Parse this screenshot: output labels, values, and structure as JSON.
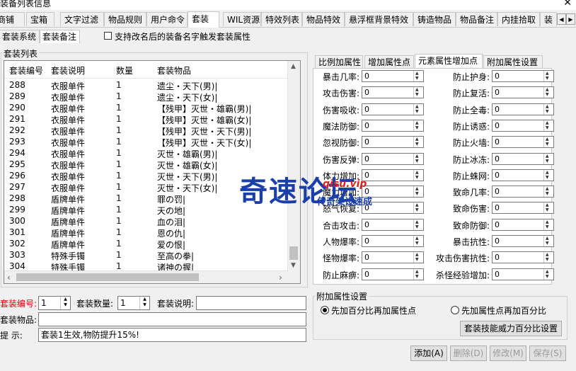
{
  "window": {
    "title": "装备列表信息",
    "close_glyph": "✕"
  },
  "top_tabs": [
    "商铺",
    "宝箱",
    "文字过滤",
    "物品规则",
    "用户命令",
    "套装",
    "WIL资源",
    "特效列表",
    "物品特效",
    "悬浮框背景特效",
    "铸造物品",
    "物品备注",
    "内挂拾取",
    "装"
  ],
  "sub_tabs": [
    "套装系统",
    "套装备注"
  ],
  "option_checkbox": {
    "label": "支持改名后的装备名字触发套装属性",
    "checked": false
  },
  "list_group": {
    "label": "套装列表",
    "columns": [
      "套装编号",
      "套装说明",
      "数量",
      "套装物品"
    ],
    "rows": [
      [
        "288",
        "衣服单件",
        "1",
        "遗尘・天下(男)|"
      ],
      [
        "289",
        "衣服单件",
        "1",
        "遗尘・天下(女)|"
      ],
      [
        "290",
        "衣服单件",
        "1",
        "【残甲】灭世・雄霸(男)|"
      ],
      [
        "291",
        "衣服单件",
        "1",
        "【残甲】灭世・雄霸(女)|"
      ],
      [
        "292",
        "衣服单件",
        "1",
        "【残甲】灭世・天下(男)|"
      ],
      [
        "293",
        "衣服单件",
        "1",
        "【残甲】灭世・天下(女)|"
      ],
      [
        "294",
        "衣服单件",
        "1",
        "灭世・雄霸(男)|"
      ],
      [
        "295",
        "衣服单件",
        "1",
        "灭世・雄霸(女)|"
      ],
      [
        "296",
        "衣服单件",
        "1",
        "灭世・天下(男)|"
      ],
      [
        "297",
        "衣服单件",
        "1",
        "灭世・天下(女)|"
      ],
      [
        "298",
        "盾牌单件",
        "1",
        "罪の罚|"
      ],
      [
        "299",
        "盾牌单件",
        "1",
        "天の地|"
      ],
      [
        "300",
        "盾牌单件",
        "1",
        "血の泪|"
      ],
      [
        "301",
        "盾牌单件",
        "1",
        "恩の仇|"
      ],
      [
        "302",
        "盾牌单件",
        "1",
        "爱の恨|"
      ],
      [
        "303",
        "特殊手镯",
        "1",
        "至高の拳|"
      ],
      [
        "304",
        "特殊手镯",
        "1",
        "诸神の握|"
      ]
    ]
  },
  "attr_tabs": [
    "比例加属性",
    "增加属性点",
    "元素属性增加点",
    "附加属性设置"
  ],
  "attr_fields_left": [
    {
      "label": "暴击几率:",
      "value": "0"
    },
    {
      "label": "攻击伤害:",
      "value": "0"
    },
    {
      "label": "伤害吸收:",
      "value": "0"
    },
    {
      "label": "魔法防御:",
      "value": "0"
    },
    {
      "label": "忽视防御:",
      "value": "0"
    },
    {
      "label": "伤害反弹:",
      "value": "0"
    },
    {
      "label": "体力增加:",
      "value": "0"
    },
    {
      "label": "魔力增加:",
      "value": "0"
    },
    {
      "label": "怒气恢复:",
      "value": "0"
    },
    {
      "label": "合击攻击:",
      "value": "0"
    },
    {
      "label": "人物爆率:",
      "value": "0"
    },
    {
      "label": "怪物爆率:",
      "value": "0"
    },
    {
      "label": "防止麻痹:",
      "value": "0"
    }
  ],
  "attr_fields_right": [
    {
      "label": "防止护身:",
      "value": "0"
    },
    {
      "label": "防止复活:",
      "value": "0"
    },
    {
      "label": "防止全毒:",
      "value": "0"
    },
    {
      "label": "防止诱惑:",
      "value": "0"
    },
    {
      "label": "防止火墙:",
      "value": "0"
    },
    {
      "label": "防止冰冻:",
      "value": "0"
    },
    {
      "label": "防止蛛网:",
      "value": "0"
    },
    {
      "label": "致命几率:",
      "value": "0"
    },
    {
      "label": "致命伤害:",
      "value": "0"
    },
    {
      "label": "致命防御:",
      "value": "0"
    },
    {
      "label": "暴击抗性:",
      "value": "0"
    },
    {
      "label": "攻击伤害抗性:",
      "value": "0"
    },
    {
      "label": "杀怪经验增加:",
      "value": "0"
    }
  ],
  "extra_group": {
    "label": "附加属性设置",
    "radio_1": "先加百分比再加属性点",
    "radio_2": "先加属性点再加百分比",
    "selected": "radio_1",
    "skill_button": "套装技能威力百分比设置"
  },
  "form": {
    "id_label": "套装编号:",
    "id_value": "1",
    "count_label": "套装数量:",
    "count_value": "1",
    "desc_label": "套装说明:",
    "desc_value": "",
    "items_label": "套装物品:",
    "items_value": "",
    "hint_label": "提  示:",
    "hint_value": "套装1生效,物防提升15%!"
  },
  "buttons": {
    "add": "添加(A)",
    "delete": "删除(D)",
    "modify": "修改(M)",
    "save": "保存(S)"
  },
  "watermark": {
    "main": "奇速论坛",
    "url": "qisu.vip",
    "slogan": "传奇架设速成"
  },
  "colors": {
    "required_label": "#e00000",
    "watermark_blue": "#1b3fa8",
    "watermark_red": "#e02020"
  }
}
